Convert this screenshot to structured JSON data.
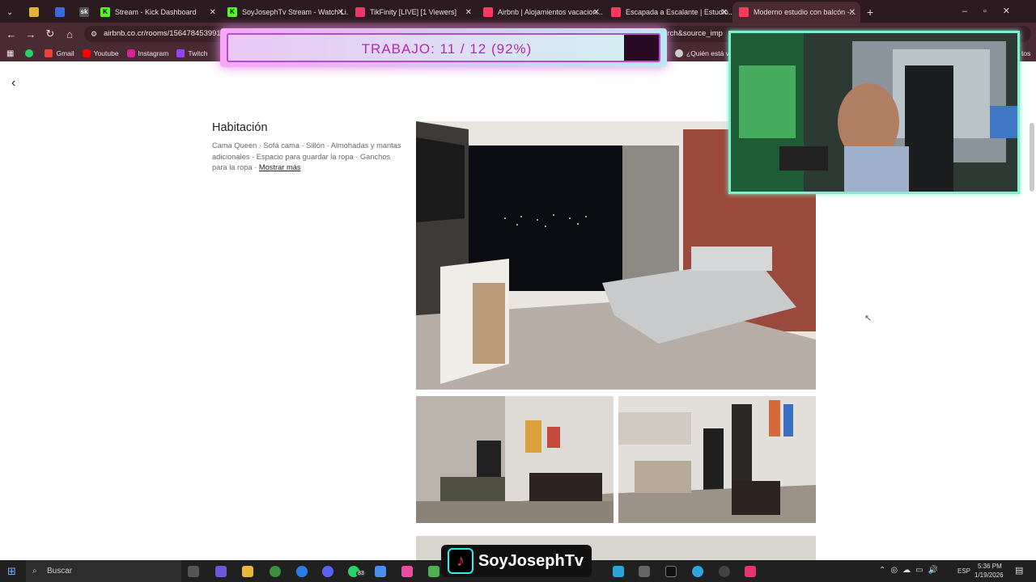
{
  "tabs": [
    {
      "label": "",
      "color": "#e0b43c"
    },
    {
      "label": "",
      "color": "#3a6bd8"
    },
    {
      "label": "",
      "color": "#444"
    },
    {
      "label": "Stream - Kick Dashboard",
      "color": "#53fc18"
    },
    {
      "label": "SoyJosephTv Stream - Watch Li...",
      "color": "#53fc18"
    },
    {
      "label": "TikFinity [LIVE] [1 Viewers]",
      "color": "#e83a6a"
    },
    {
      "label": "Airbnb | Alojamientos vacacion...",
      "color": "#ff385c"
    },
    {
      "label": "Escapada a Escalante | Estudio...",
      "color": "#ff385c"
    },
    {
      "label": "Moderno estudio con balcón -...",
      "color": "#ff385c"
    }
  ],
  "address": {
    "url": "airbnb.co.cr/rooms/156478453991",
    "url_tail": "arch&source_imp"
  },
  "bookmarks": [
    {
      "label": "Gmail",
      "color": "#ea4335"
    },
    {
      "label": "Youtube",
      "color": "#ff0000"
    },
    {
      "label": "Instagram",
      "color": "#d6249f"
    },
    {
      "label": "Twitch",
      "color": "#9146ff"
    }
  ],
  "bookmark_right": "¿Quién está vie",
  "bookmark_far_right": "tos",
  "progress": {
    "label": "TRABAJO:  11 / 12 (92%)",
    "fraction": 0.92
  },
  "room": {
    "title": "Habitación",
    "description": "Cama Queen · Sofá cama · Sillón · Almohadas y mantas adicionales · Espacio para guardar la ropa · Ganchos para la ropa · ",
    "more_link": "Mostrar más"
  },
  "taskbar": {
    "search_placeholder": "Buscar",
    "time": "5:36 PM",
    "date": "1/19/2026",
    "lang": "ESP",
    "whatsapp_badge": "83"
  },
  "streamer": {
    "name": "SoyJosephTv"
  }
}
